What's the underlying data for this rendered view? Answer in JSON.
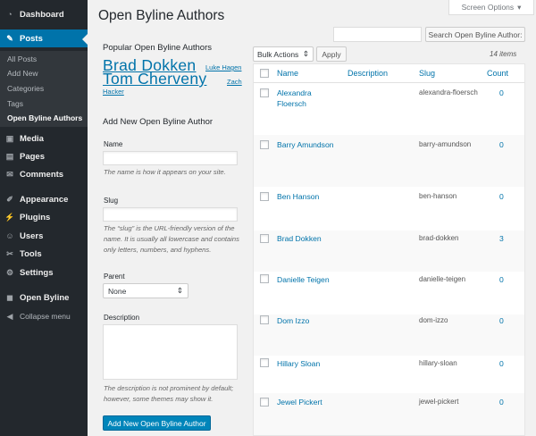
{
  "sidebar": {
    "items": [
      {
        "label": "Dashboard",
        "icon": "dashboard-icon",
        "glyph": "◔"
      },
      {
        "label": "Posts",
        "icon": "pin-icon",
        "glyph": "✎"
      },
      {
        "label": "Media",
        "icon": "media-icon",
        "glyph": "▣"
      },
      {
        "label": "Pages",
        "icon": "pages-icon",
        "glyph": "▤"
      },
      {
        "label": "Comments",
        "icon": "comments-icon",
        "glyph": "✉"
      },
      {
        "label": "Appearance",
        "icon": "appearance-icon",
        "glyph": "✐"
      },
      {
        "label": "Plugins",
        "icon": "plugins-icon",
        "glyph": "⚡"
      },
      {
        "label": "Users",
        "icon": "users-icon",
        "glyph": "☺"
      },
      {
        "label": "Tools",
        "icon": "tools-icon",
        "glyph": "✂"
      },
      {
        "label": "Settings",
        "icon": "settings-icon",
        "glyph": "⚙"
      },
      {
        "label": "Open Byline",
        "icon": "open-byline-icon",
        "glyph": "◼"
      },
      {
        "label": "Collapse menu",
        "icon": "collapse-icon",
        "glyph": "◀"
      }
    ],
    "submenu": [
      "All Posts",
      "Add New",
      "Categories",
      "Tags",
      "Open Byline Authors"
    ]
  },
  "header": {
    "title": "Open Byline Authors",
    "screen_options": "Screen Options",
    "screen_options_arrow": "▾"
  },
  "popular": {
    "title": "Popular Open Byline Authors",
    "cloud": [
      "Brad Dokken",
      "Luke Hagen",
      "Tom Cherveny",
      "Zach Hacker"
    ]
  },
  "form": {
    "title": "Add New Open Byline Author",
    "name_label": "Name",
    "name_desc": "The name is how it appears on your site.",
    "slug_label": "Slug",
    "slug_desc": "The “slug” is the URL-friendly version of the name. It is usually all lowercase and contains only letters, numbers, and hyphens.",
    "parent_label": "Parent",
    "parent_value": "None",
    "description_label": "Description",
    "description_desc": "The description is not prominent by default; however, some themes may show it.",
    "submit": "Add New Open Byline Author"
  },
  "search": {
    "button": "Search Open Byline Author:"
  },
  "bulk": {
    "select": "Bulk Actions",
    "apply": "Apply",
    "items_count": "14 items"
  },
  "table": {
    "columns": [
      "Name",
      "Description",
      "Slug",
      "Count"
    ],
    "rows": [
      {
        "name": "Alexandra Floersch",
        "slug": "alexandra-floersch",
        "count": "0"
      },
      {
        "name": "Barry Amundson",
        "slug": "barry-amundson",
        "count": "0"
      },
      {
        "name": "Ben Hanson",
        "slug": "ben-hanson",
        "count": "0"
      },
      {
        "name": "Brad Dokken",
        "slug": "brad-dokken",
        "count": "3"
      },
      {
        "name": "Danielle Teigen",
        "slug": "danielle-teigen",
        "count": "0"
      },
      {
        "name": "Dom Izzo",
        "slug": "dom-izzo",
        "count": "0"
      },
      {
        "name": "Hillary Sloan",
        "slug": "hillary-sloan",
        "count": "0"
      },
      {
        "name": "Jewel Pickert",
        "slug": "jewel-pickert",
        "count": "0"
      }
    ]
  },
  "colors": {
    "sidebar_bg": "#23282d",
    "accent": "#0073aa",
    "primary_button": "#0085ba"
  }
}
